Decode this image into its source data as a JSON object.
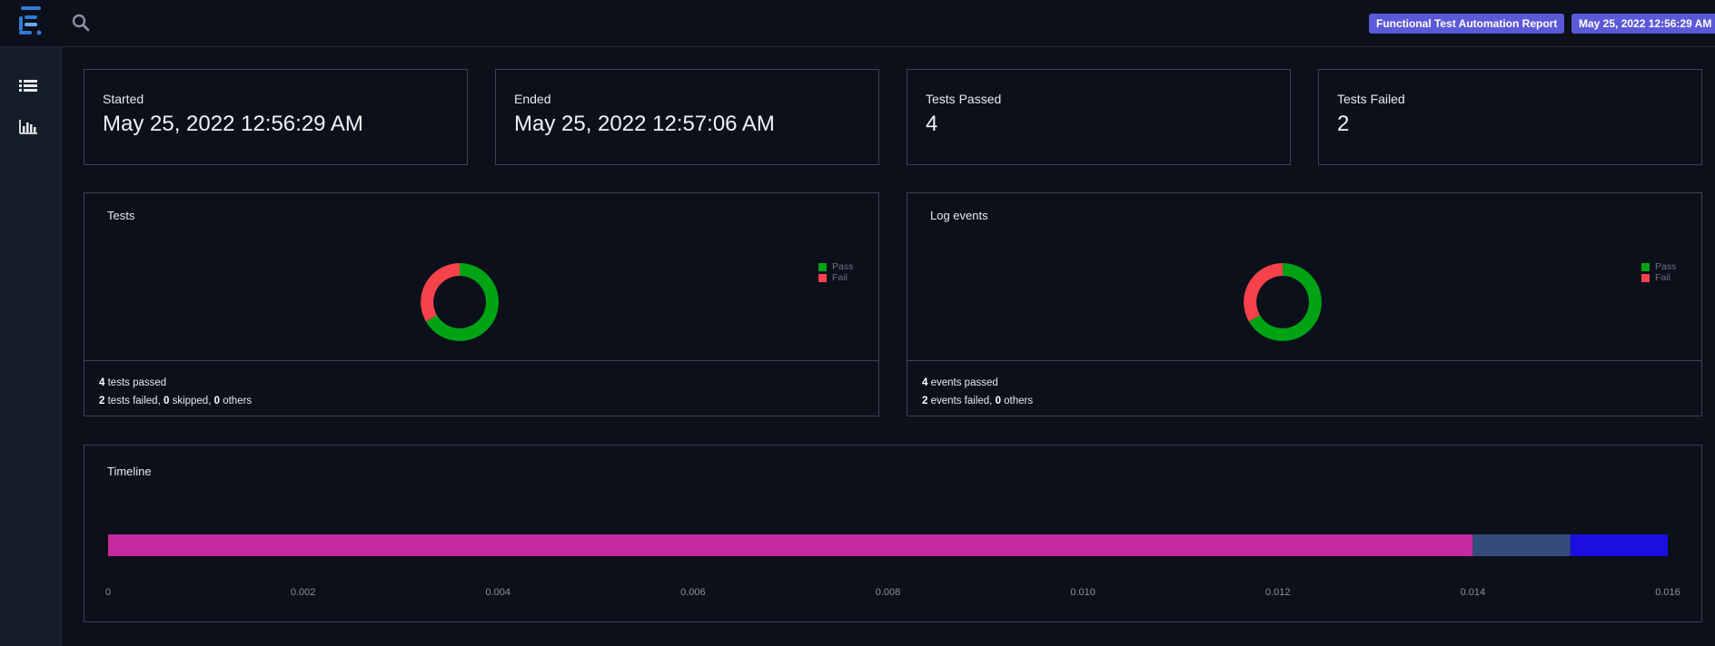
{
  "header": {
    "report_badge": "Functional Test Automation Report",
    "date_badge": "May 25, 2022 12:56:29 AM"
  },
  "sidebar": {
    "items": [
      {
        "icon": "list-icon"
      },
      {
        "icon": "bar-chart-icon"
      }
    ]
  },
  "stats": [
    {
      "label": "Started",
      "value": "May 25, 2022 12:56:29 AM"
    },
    {
      "label": "Ended",
      "value": "May 25, 2022 12:57:06 AM"
    },
    {
      "label": "Tests Passed",
      "value": "4"
    },
    {
      "label": "Tests Failed",
      "value": "2"
    }
  ],
  "colors": {
    "pass": "#00a313",
    "fail": "#f5424b"
  },
  "tests_panel": {
    "title": "Tests",
    "legend": [
      "Pass",
      "Fail"
    ],
    "passed_count": "4",
    "passed_text": " tests passed",
    "failed_count": "2",
    "failed_text": " tests failed, ",
    "skipped_count": "0",
    "skipped_text": " skipped, ",
    "others_count": "0",
    "others_text": " others"
  },
  "events_panel": {
    "title": "Log events",
    "legend": [
      "Pass",
      "Fail"
    ],
    "passed_count": "4",
    "passed_text": " events passed",
    "failed_count": "2",
    "failed_text": " events failed, ",
    "others_count": "0",
    "others_text": " others"
  },
  "chart_data": [
    {
      "type": "pie",
      "name": "tests-donut",
      "categories": [
        "Pass",
        "Fail"
      ],
      "values": [
        4,
        2
      ],
      "colors": [
        "#00a313",
        "#f5424b"
      ],
      "legend": "right"
    },
    {
      "type": "pie",
      "name": "events-donut",
      "categories": [
        "Pass",
        "Fail"
      ],
      "values": [
        4,
        2
      ],
      "colors": [
        "#00a313",
        "#f5424b"
      ],
      "legend": "right"
    },
    {
      "type": "bar",
      "name": "timeline",
      "title": "Timeline",
      "orientation": "horizontal-stacked",
      "segments": [
        {
          "value": 0.014,
          "color": "#c42a9e"
        },
        {
          "value": 0.001,
          "color": "#334c7a"
        },
        {
          "value": 0.001,
          "color": "#1a0fe0"
        }
      ],
      "xlim": [
        0,
        0.016
      ],
      "ticks": [
        "0",
        "0.002",
        "0.004",
        "0.006",
        "0.008",
        "0.010",
        "0.012",
        "0.014",
        "0.016"
      ]
    }
  ]
}
